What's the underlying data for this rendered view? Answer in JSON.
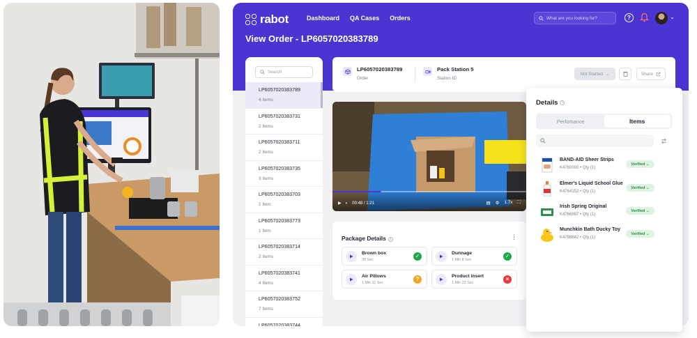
{
  "app": {
    "logo_text": "rabot",
    "nav": [
      "Dashboard",
      "QA Cases",
      "Orders"
    ],
    "search_placeholder": "What are you looking for?",
    "page_title": "View Order - LP6057020383789",
    "brand_color": "#4a35d3"
  },
  "sidebar": {
    "search_placeholder": "Search",
    "orders": [
      {
        "id": "LP6057020383789",
        "count": "4 Items"
      },
      {
        "id": "LP6057020383731",
        "count": "2 Items"
      },
      {
        "id": "LP6057020383711",
        "count": "2 Items"
      },
      {
        "id": "LP6057020383735",
        "count": "3 Items"
      },
      {
        "id": "LP6057020383703",
        "count": "1 Item"
      },
      {
        "id": "LP6057020383773",
        "count": "1 Item"
      },
      {
        "id": "LP6057020383714",
        "count": "2 Items"
      },
      {
        "id": "LP6057020383741",
        "count": "4 Items"
      },
      {
        "id": "LP6057020383752",
        "count": "7 Items"
      },
      {
        "id": "LP6057020383744",
        "count": ""
      }
    ]
  },
  "infobar": {
    "order_id": "LP6057020383789",
    "order_label": "Order",
    "station_name": "Pack Station 5",
    "station_label": "Station ID",
    "status": "Not Started",
    "share_label": "Share"
  },
  "video": {
    "time": "00:48 / 1:21",
    "speed": "1.7x",
    "progress": 0.25
  },
  "package": {
    "title": "Package Details",
    "items": [
      {
        "name": "Brown box",
        "time": "38 Sec",
        "status": "ok"
      },
      {
        "name": "Dunnage",
        "time": "1 Min 8 Sec",
        "status": "ok"
      },
      {
        "name": "Air Pillows",
        "time": "1 Min 11 Sec",
        "status": "warn"
      },
      {
        "name": "Product insert",
        "time": "1 Min 22 Sec",
        "status": "error"
      }
    ],
    "colors": {
      "ok": "#1ea84a",
      "warn": "#f2a622",
      "error": "#e33a3a"
    }
  },
  "details": {
    "title": "Details",
    "tabs": [
      "Perfomance",
      "Items"
    ],
    "active_tab": "Items",
    "items": [
      {
        "name": "BAND-AID Sheer Strips",
        "sku": "K4760000",
        "qty": "Qty (1)",
        "badge": "Verified",
        "icon": "bandage-box-icon"
      },
      {
        "name": "Elmer's Liquid School Glue",
        "sku": "K4764152",
        "qty": "Qty (1)",
        "badge": "Verified",
        "icon": "glue-bottle-icon"
      },
      {
        "name": "Irish Spring Original",
        "sku": "K4766997",
        "qty": "Qty (1)",
        "badge": "Verified",
        "icon": "soap-bar-icon"
      },
      {
        "name": "Munchkin Bath Ducky Toy",
        "sku": "K4788842",
        "qty": "Qty (1)",
        "badge": "Verified",
        "icon": "rubber-duck-icon"
      }
    ]
  }
}
